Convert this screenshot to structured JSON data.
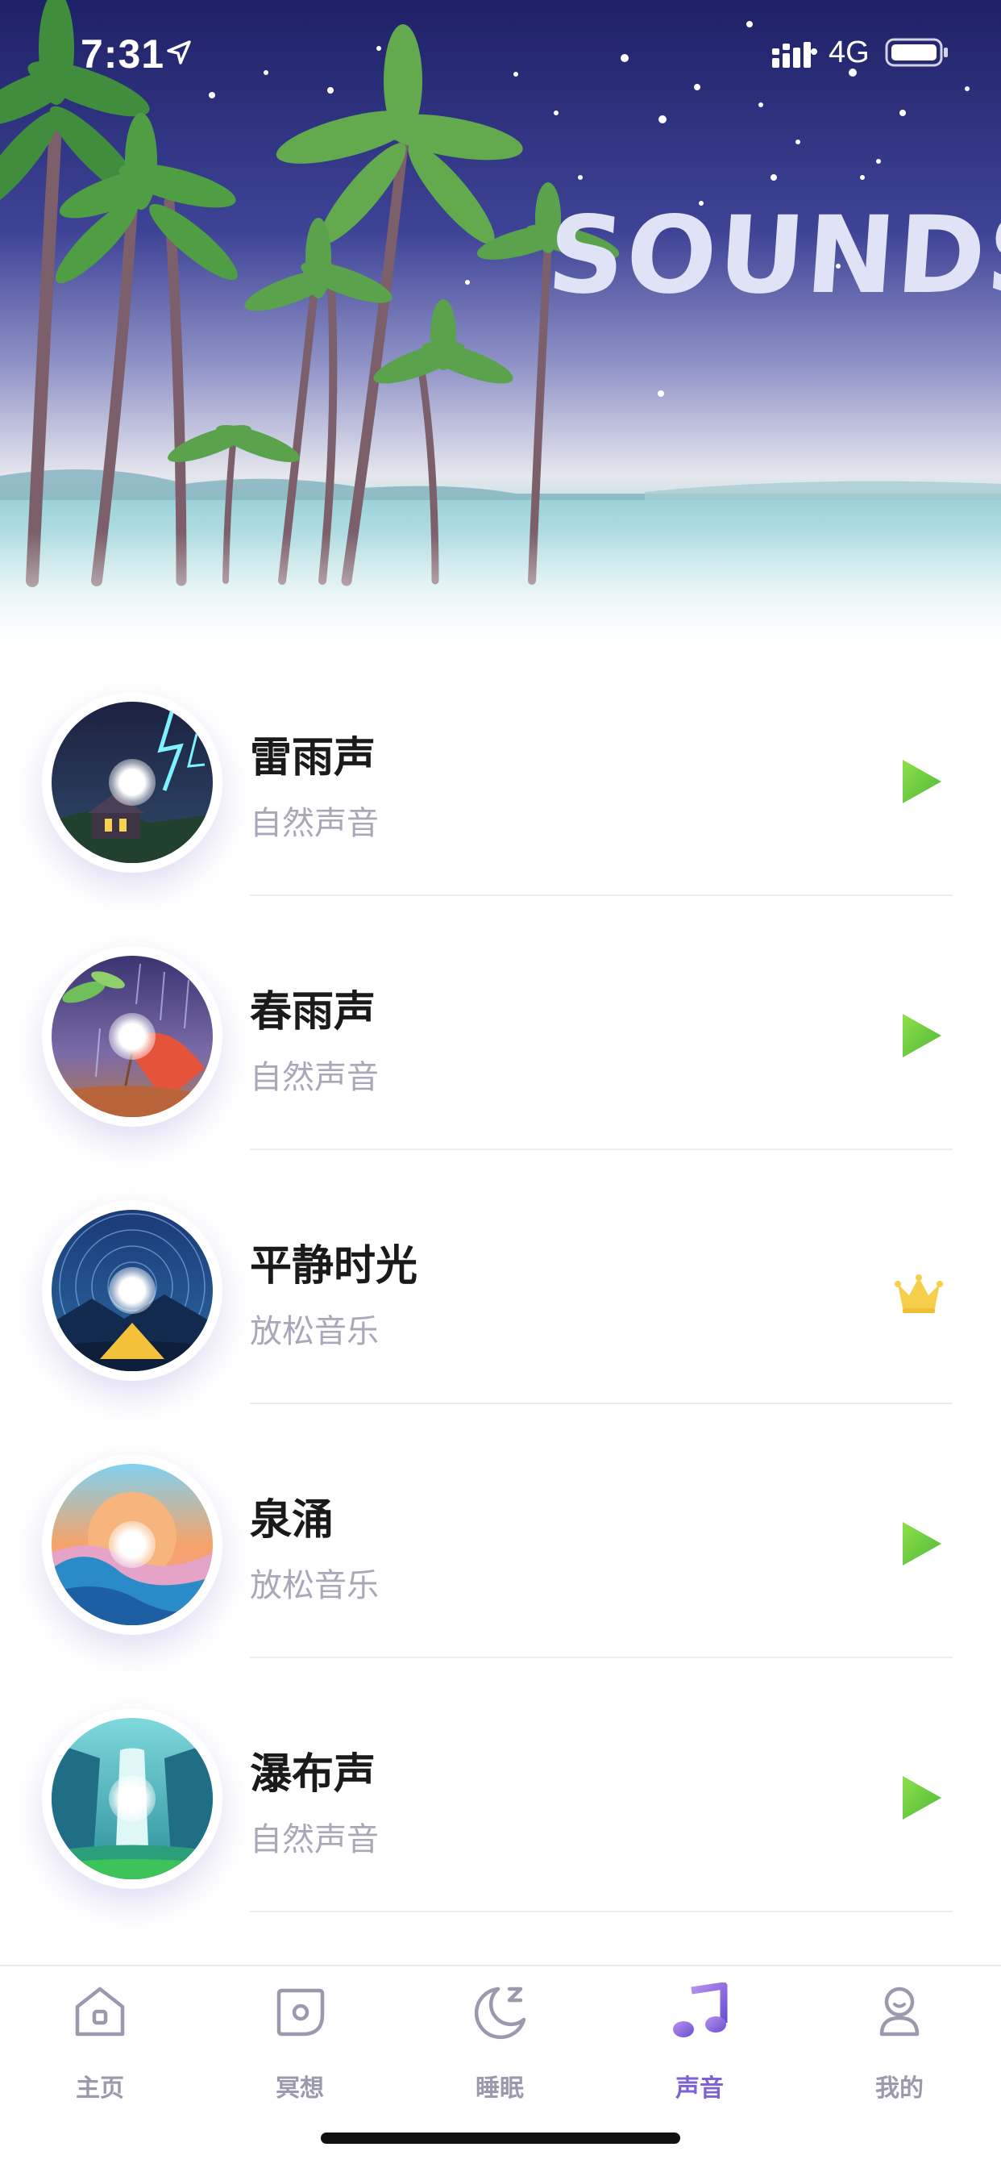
{
  "status_bar": {
    "time": "7:31",
    "network": "4G"
  },
  "hero": {
    "title": "SOUNDS"
  },
  "sounds": [
    {
      "title": "雷雨声",
      "subtitle": "自然声音",
      "action_icon": "play-icon",
      "theme": "thunderstorm"
    },
    {
      "title": "春雨声",
      "subtitle": "自然声音",
      "action_icon": "play-icon",
      "theme": "spring-rain"
    },
    {
      "title": "平静时光",
      "subtitle": "放松音乐",
      "action_icon": "crown-icon",
      "theme": "starry-night"
    },
    {
      "title": "泉涌",
      "subtitle": "放松音乐",
      "action_icon": "play-icon",
      "theme": "spring-wave"
    },
    {
      "title": "瀑布声",
      "subtitle": "自然声音",
      "action_icon": "play-icon",
      "theme": "waterfall"
    }
  ],
  "tabs": [
    {
      "label": "主页",
      "icon": "home-icon",
      "active": false
    },
    {
      "label": "冥想",
      "icon": "meditation-icon",
      "active": false
    },
    {
      "label": "睡眠",
      "icon": "moon-icon",
      "active": false
    },
    {
      "label": "声音",
      "icon": "music-note-icon",
      "active": true
    },
    {
      "label": "我的",
      "icon": "profile-icon",
      "active": false
    }
  ],
  "colors": {
    "accent": "#7d62d6",
    "play_green": "#6cc83c",
    "crown_gold": "#f5cf4a",
    "sky_top": "#1e2166",
    "sky_mid": "#4a4fa0"
  }
}
